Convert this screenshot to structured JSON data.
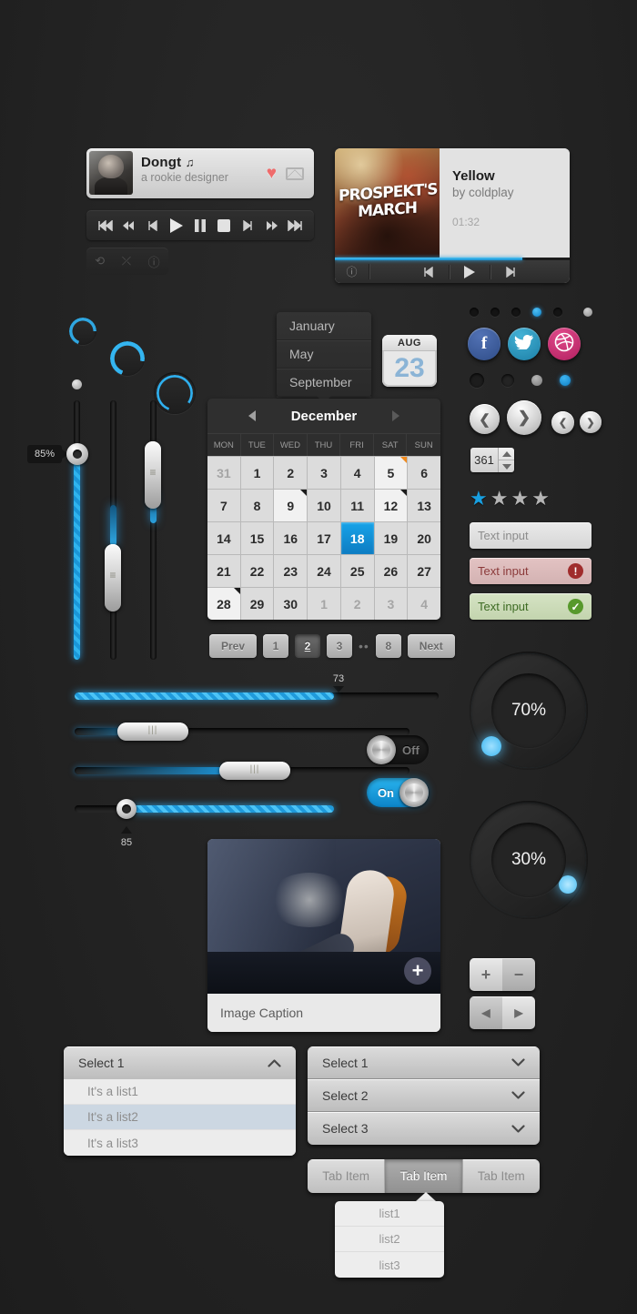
{
  "profile": {
    "name": "Dongt",
    "music_icon": "♫",
    "subtitle": "a rookie designer",
    "heart_icon": "♥",
    "mail_icon": "mail-icon"
  },
  "transport": {
    "buttons": [
      "skip-start-icon",
      "rewind-icon",
      "prev-track-icon",
      "play-icon",
      "pause-icon",
      "stop-icon",
      "next-track-icon",
      "fast-forward-icon",
      "skip-end-icon"
    ],
    "extras": [
      "repeat-icon",
      "shuffle-icon",
      "info-icon"
    ],
    "extra_glyphs": [
      "⟲",
      "⤫",
      "ⓘ"
    ]
  },
  "album": {
    "art_text_line1": "PROSPEKT'S",
    "art_text_line2": "MARCH",
    "title": "Yellow",
    "artist": "by coldplay",
    "time": "01:32",
    "progress_pct": 80,
    "info_glyph": "ⓘ",
    "prev_icon": "prev-track-icon",
    "play_icon": "play-icon",
    "next_icon": "next-track-icon"
  },
  "loaders": [
    {
      "size": 30,
      "label": "loader-small"
    },
    {
      "size": 38,
      "label": "loader-medium"
    },
    {
      "size": 46,
      "label": "loader-large"
    }
  ],
  "month_popover": {
    "items": [
      "January",
      "May",
      "September"
    ]
  },
  "date_badge": {
    "month": "AUG",
    "day": "23"
  },
  "calendar": {
    "title": "December",
    "prev_icon": "chevron-left-icon",
    "next_icon": "chevron-right-icon",
    "dow": [
      "MON",
      "TUE",
      "WED",
      "THU",
      "FRI",
      "SAT",
      "SUN"
    ],
    "weeks": [
      [
        {
          "d": "31",
          "s": "mut"
        },
        {
          "d": "1"
        },
        {
          "d": "2"
        },
        {
          "d": "3"
        },
        {
          "d": "4"
        },
        {
          "d": "5",
          "s": "lt",
          "corner": "orange"
        },
        {
          "d": "6"
        }
      ],
      [
        {
          "d": "7"
        },
        {
          "d": "8"
        },
        {
          "d": "9",
          "s": "lt",
          "corner": "dark"
        },
        {
          "d": "10"
        },
        {
          "d": "11"
        },
        {
          "d": "12",
          "s": "lt",
          "corner": "dark"
        },
        {
          "d": "13"
        }
      ],
      [
        {
          "d": "14"
        },
        {
          "d": "15"
        },
        {
          "d": "16"
        },
        {
          "d": "17"
        },
        {
          "d": "18",
          "s": "sel"
        },
        {
          "d": "19"
        },
        {
          "d": "20"
        }
      ],
      [
        {
          "d": "21"
        },
        {
          "d": "22"
        },
        {
          "d": "23"
        },
        {
          "d": "24"
        },
        {
          "d": "25"
        },
        {
          "d": "26"
        },
        {
          "d": "27"
        }
      ],
      [
        {
          "d": "28",
          "s": "lt",
          "corner": "dark"
        },
        {
          "d": "29"
        },
        {
          "d": "30"
        },
        {
          "d": "1",
          "s": "mut"
        },
        {
          "d": "2",
          "s": "mut"
        },
        {
          "d": "3",
          "s": "mut"
        },
        {
          "d": "4",
          "s": "mut"
        }
      ]
    ]
  },
  "pagination": {
    "prev_label": "Prev",
    "next_label": "Next",
    "pages": [
      "1",
      "2",
      "3"
    ],
    "active_page": "2",
    "ellipsis": "••",
    "last_page": "8"
  },
  "vertical_sliders": {
    "tooltip_value": "85%",
    "sliders": [
      {
        "name": "slider-1",
        "value": 85,
        "knob": "round"
      },
      {
        "name": "slider-2",
        "value": 42,
        "knob": "pill"
      },
      {
        "name": "slider-3",
        "value": 72,
        "knob": "pill"
      }
    ]
  },
  "horizontal_sliders": [
    {
      "name": "h-slider-striped",
      "value": 73,
      "tooltip": "73",
      "tooltip_pos": "top",
      "knob": "none"
    },
    {
      "name": "h-slider-pill-1",
      "value": 27,
      "knob": "pill"
    },
    {
      "name": "h-slider-pill-2",
      "value": 53,
      "knob": "pill"
    },
    {
      "name": "h-slider-round",
      "value": 85,
      "tooltip": "85",
      "tooltip_pos": "bottom",
      "knob": "round"
    }
  ],
  "toggles": {
    "off_label": "Off",
    "on_label": "On"
  },
  "dots_top": {
    "count": 6,
    "active_index": 3,
    "light_index": 5
  },
  "social": [
    {
      "name": "facebook",
      "glyph": "f",
      "color": "#3c5a98"
    },
    {
      "name": "twitter",
      "glyph": "🐦",
      "color": "#2b9bc4"
    },
    {
      "name": "dribbble",
      "glyph": "◉",
      "color": "#c62a6e"
    }
  ],
  "dots_bottom": {
    "count": 4,
    "active_index": 3
  },
  "nav_buttons": {
    "left_icon": "chevron-left-icon",
    "right_icon": "chevron-right-icon",
    "left_glyph": "❮",
    "right_glyph": "❯"
  },
  "spinner": {
    "value": "361",
    "up_icon": "caret-up-icon",
    "down_icon": "caret-down-icon"
  },
  "rating": {
    "total": 4,
    "filled": 1,
    "star_glyph": "★"
  },
  "text_inputs": [
    {
      "name": "text-input-normal",
      "value": "Text input",
      "state": "normal",
      "badge": ""
    },
    {
      "name": "text-input-error",
      "value": "Text input",
      "state": "error",
      "badge": "!"
    },
    {
      "name": "text-input-success",
      "value": "Text input",
      "state": "success",
      "badge": "✓"
    }
  ],
  "chart_data": {
    "type": "pie",
    "title": "Circular progress rings",
    "series": [
      {
        "name": "ring-70",
        "label": "70%",
        "value": 70,
        "max": 100
      },
      {
        "name": "ring-30",
        "label": "30%",
        "value": 30,
        "max": 100
      }
    ],
    "accent_color": "#2aa8e8"
  },
  "stepper_buttons": {
    "plus": "+",
    "minus": "−",
    "left": "◀",
    "right": "▶"
  },
  "image_panel": {
    "caption": "Image  Caption",
    "plus_icon": "plus-icon",
    "plus_glyph": "+"
  },
  "select_open": {
    "label": "Select 1",
    "chevron": "chevron-up-icon",
    "chevron_glyph": "⌃",
    "options": [
      "It's a list1",
      "It's a list2",
      "It's a list3"
    ],
    "highlighted_index": 1
  },
  "select_stack": {
    "items": [
      "Select 1",
      "Select 2",
      "Select 3"
    ],
    "chevron": "chevron-down-icon",
    "chevron_glyph": "⌄"
  },
  "tabs": {
    "items": [
      "Tab Item",
      "Tab Item",
      "Tab Item"
    ],
    "active_index": 1,
    "dropdown": [
      "list1",
      "list2",
      "list3"
    ]
  },
  "colors": {
    "accent_blue": "#2aa8e8",
    "background": "#232323",
    "error_red": "#b03030",
    "success_green": "#5a9e2e",
    "orange_flag": "#f08a1e"
  }
}
